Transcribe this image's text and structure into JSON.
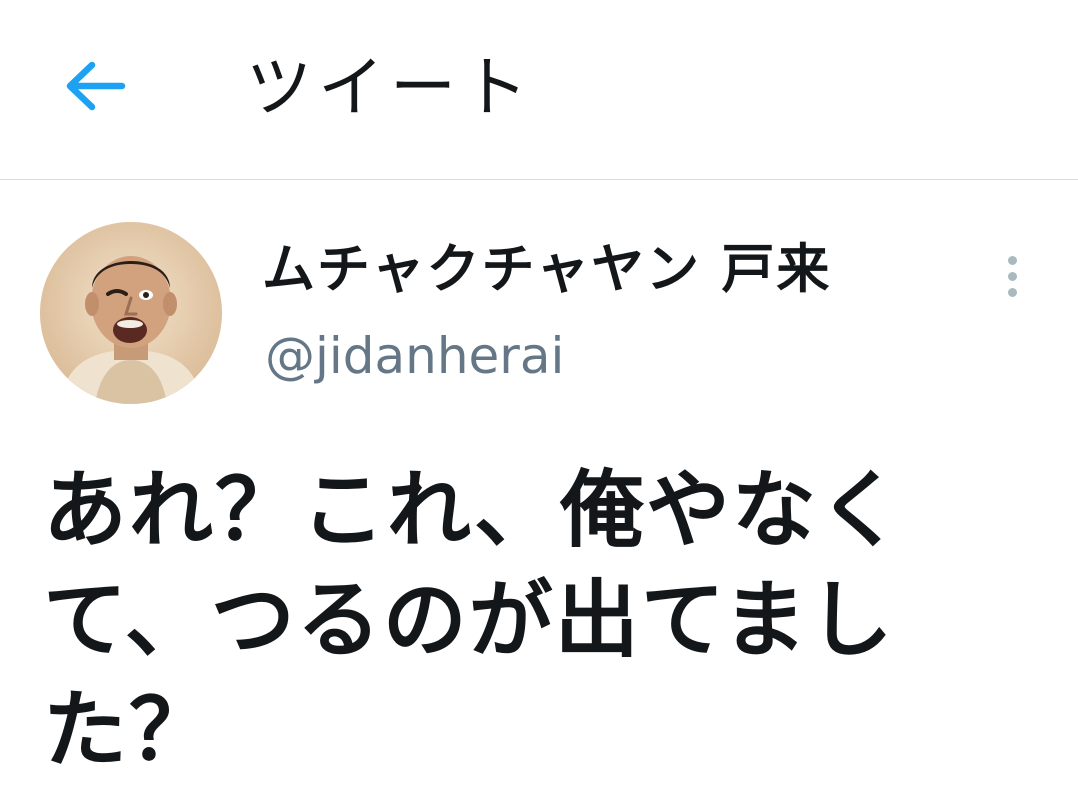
{
  "header": {
    "back_icon": "arrow-left-icon",
    "title": "ツイート"
  },
  "tweet": {
    "author": {
      "display_name": "ムチャクチャヤン 戸来",
      "handle": "@jidanherai",
      "avatar": "profile-photo"
    },
    "more_icon": "vertical-dots-icon",
    "text": "あれ？これ、俺やなくて、つるのが出てました？"
  },
  "colors": {
    "accent": "#1da1f2",
    "text_primary": "#14171a",
    "text_secondary": "#657786",
    "divider": "#d9dde1",
    "icon_muted": "#aab8c2"
  }
}
